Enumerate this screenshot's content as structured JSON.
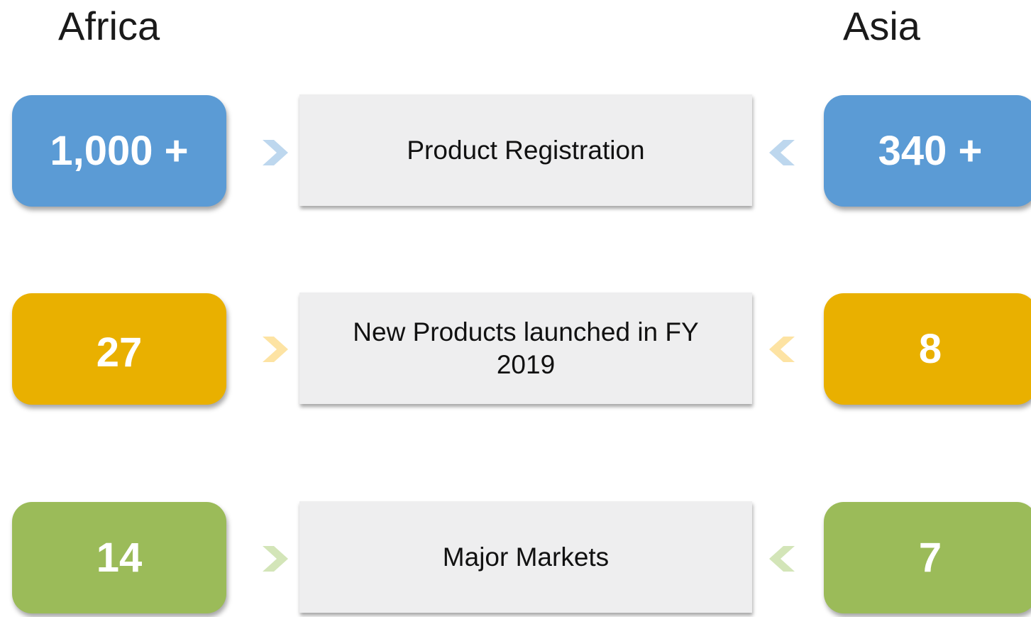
{
  "headings": {
    "left": "Africa",
    "right": "Asia"
  },
  "rows": [
    {
      "left_value": "1,000 +",
      "label": "Product Registration",
      "right_value": "340 +",
      "color": "#5b9bd5",
      "chevron_color": "#bdd7ee"
    },
    {
      "left_value": "27",
      "label": "New Products launched in FY 2019",
      "right_value": "8",
      "color": "#e9b000",
      "chevron_color": "#fde3a3"
    },
    {
      "left_value": "14",
      "label": "Major Markets",
      "right_value": "7",
      "color": "#9bbb59",
      "chevron_color": "#d3e5b8"
    }
  ],
  "icons": {
    "left_chevron": "chevron-right-icon",
    "right_chevron": "chevron-left-icon"
  }
}
